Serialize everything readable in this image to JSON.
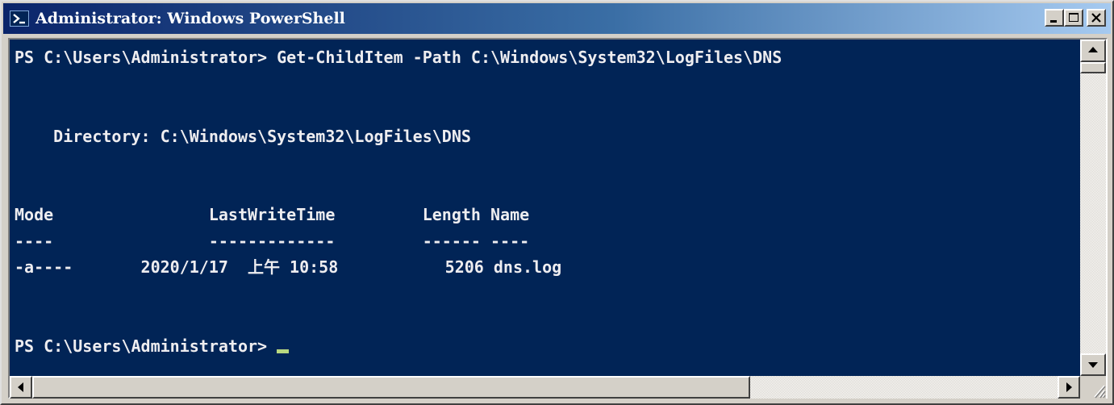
{
  "window": {
    "title": "Administrator: Windows PowerShell",
    "icon": "powershell-icon",
    "controls": [
      "minimize-icon",
      "maximize-icon",
      "close-icon"
    ]
  },
  "console": {
    "background": "#012456",
    "foreground": "#eeedf0",
    "cursor_color": "#b8d880",
    "lines": [
      "PS C:\\Users\\Administrator> Get-ChildItem -Path C:\\Windows\\System32\\LogFiles\\DNS",
      "",
      "",
      "    Directory: C:\\Windows\\System32\\LogFiles\\DNS",
      "",
      "",
      "Mode                LastWriteTime         Length Name",
      "----                -------------         ------ ----",
      "-a----       2020/1/17  上午 10:58           5206 dns.log",
      "",
      "",
      "PS C:\\Users\\Administrator> "
    ]
  },
  "scrollbars": {
    "icons": [
      "arrow-up-icon",
      "arrow-down-icon",
      "arrow-left-icon",
      "arrow-right-icon",
      "size-grip-icon"
    ]
  }
}
